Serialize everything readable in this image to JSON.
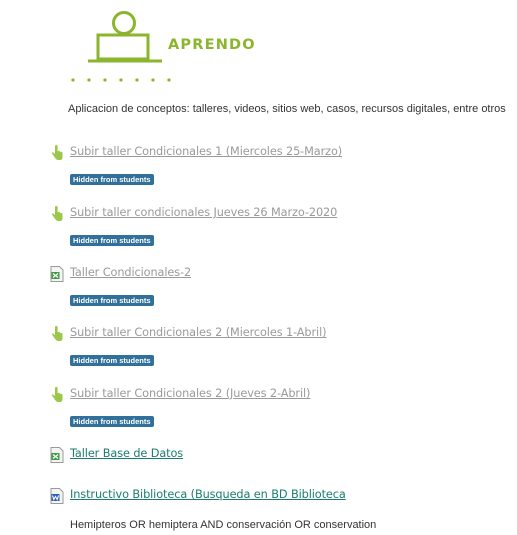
{
  "section": {
    "banner_word": "APRENDO",
    "brand_color": "#8ab52c",
    "description": "Aplicacion de conceptos: talleres, videos, sitios web, casos, recursos digitales, entre otros"
  },
  "activities": [
    {
      "title": "Subir taller Condicionales 1 (Miercoles 25-Marzo)",
      "icon": "assignment-hand-icon",
      "badge": "Hidden from students"
    },
    {
      "title": "Subir taller condicionales Jueves 26 Marzo-2020",
      "icon": "assignment-hand-icon",
      "badge": "Hidden from students"
    },
    {
      "title": "Taller Condicionales-2",
      "icon": "spreadsheet-file-icon",
      "badge": "Hidden from students"
    },
    {
      "title": "Subir taller Condicionales 2 (Miercoles 1-Abril)",
      "icon": "assignment-hand-icon",
      "badge": "Hidden from students"
    },
    {
      "title": "Subir taller Condicionales 2 (Jueves 2-Abril)",
      "icon": "assignment-hand-icon",
      "badge": "Hidden from students"
    },
    {
      "title": "Taller Base de Datos",
      "icon": "spreadsheet-file-icon"
    },
    {
      "title": "Instructivo Biblioteca (Busqueda en BD Biblioteca",
      "icon": "word-document-icon"
    }
  ],
  "footnote": "Hemipteros OR hemiptera AND conservación OR conservation",
  "colors": {
    "badge": "#31709a",
    "link": "#1a7d6e",
    "dimmed_link": "#9a9a9a"
  }
}
